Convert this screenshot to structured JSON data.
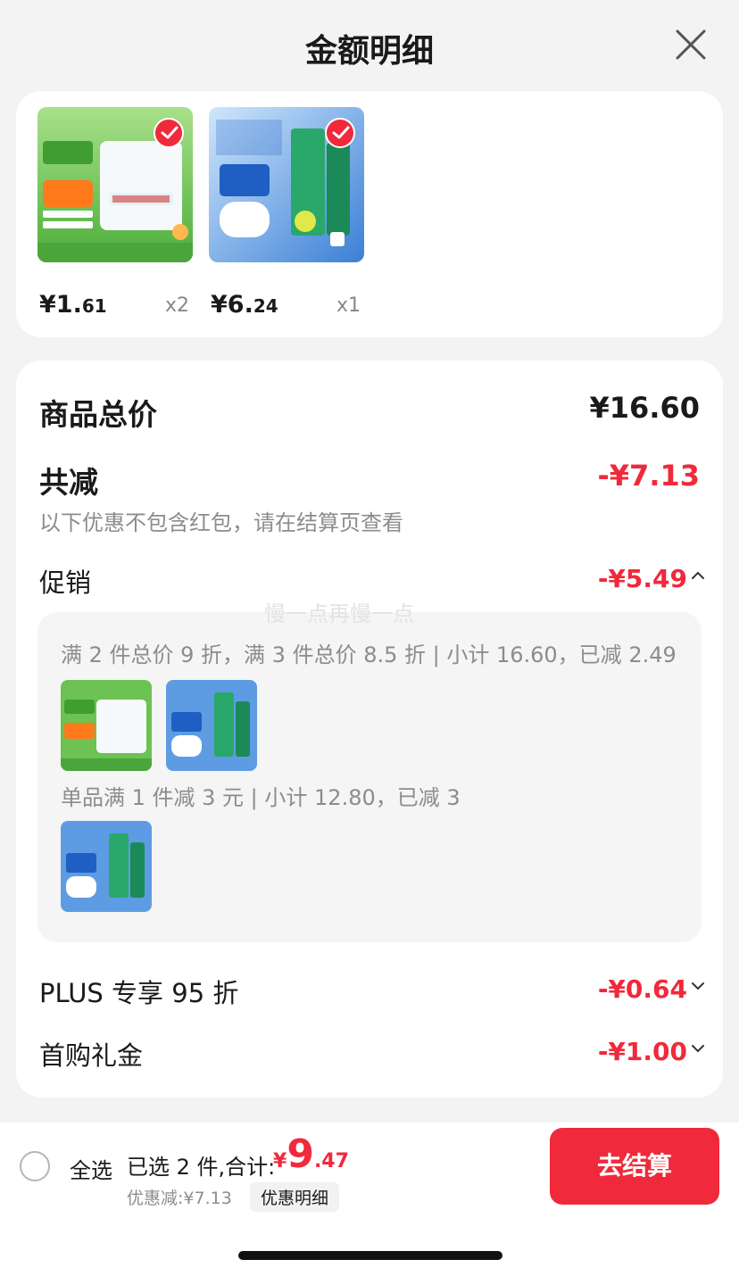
{
  "header": {
    "title": "金额明细"
  },
  "products": [
    {
      "price_main": "¥1.",
      "price_dec": "61",
      "qty": "x2",
      "image": "salt-package"
    },
    {
      "price_main": "¥6.",
      "price_dec": "24",
      "qty": "x1",
      "image": "toothpaste"
    }
  ],
  "product_total": {
    "label": "商品总价",
    "value": "¥16.60"
  },
  "reduction": {
    "label": "共减",
    "value": "-¥7.13",
    "note": "以下优惠不包含红包，请在结算页查看"
  },
  "promotion": {
    "label": "促销",
    "value": "-¥5.49",
    "rules": [
      {
        "text": "满 2 件总价 9 折，满 3 件总价 8.5 折 | 小计 16.60，已减 2.49"
      },
      {
        "text": "单品满 1 件减 3 元 | 小计 12.80，已减 3"
      }
    ]
  },
  "plus": {
    "label": "PLUS 专享 95 折",
    "value": "-¥0.64"
  },
  "first_purchase": {
    "label": "首购礼金",
    "value": "-¥1.00"
  },
  "watermark": "慢一点再慢一点",
  "bottom": {
    "select_all": "全选",
    "selected": "已选 2 件,合计:",
    "total_currency": "¥",
    "total_int": "9",
    "total_dec": ".47",
    "discount": "优惠减:¥7.13",
    "discount_detail": "优惠明细",
    "checkout": "去结算"
  },
  "colors": {
    "accent": "#f0293b",
    "background": "#f3f3f3"
  }
}
